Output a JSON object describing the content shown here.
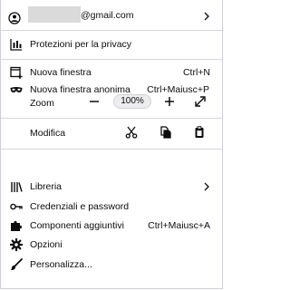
{
  "account": {
    "email_suffix": "@gmail.com"
  },
  "privacy": {
    "label": "Protezioni per la privacy"
  },
  "new_window": {
    "label": "Nuova finestra",
    "shortcut": "Ctrl+N"
  },
  "private_window": {
    "label": "Nuova finestra anonima",
    "shortcut": "Ctrl+Maiusc+P"
  },
  "zoom": {
    "label": "Zoom",
    "minus": "−",
    "value": "100%",
    "plus": "+"
  },
  "edit": {
    "label": "Modifica"
  },
  "library": {
    "label": "Libreria"
  },
  "logins": {
    "label": "Credenziali e password"
  },
  "addons": {
    "label": "Componenti aggiuntivi",
    "shortcut": "Ctrl+Maiusc+A"
  },
  "options": {
    "label": "Opzioni"
  },
  "customize": {
    "label": "Personalizza..."
  },
  "icons": {
    "account": "account-icon",
    "privacy": "privacy-dashboard-icon",
    "new_window": "new-window-icon",
    "private_window": "private-mask-icon",
    "expand": "fullscreen-icon",
    "cut": "scissors-icon",
    "copy": "copy-icon",
    "paste": "paste-icon",
    "library": "library-icon",
    "logins": "key-icon",
    "addons": "puzzle-icon",
    "options": "gear-icon",
    "customize": "brush-icon"
  }
}
